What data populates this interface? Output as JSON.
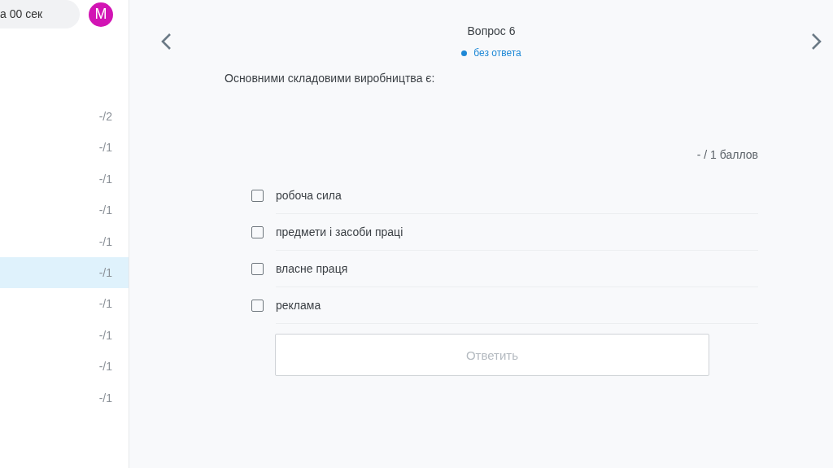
{
  "timer": {
    "text": "а 00 сек"
  },
  "avatar": {
    "letter": "M"
  },
  "sidebar": {
    "items": [
      {
        "score": "-/2",
        "selected": false
      },
      {
        "score": "-/1",
        "selected": false
      },
      {
        "score": "-/1",
        "selected": false
      },
      {
        "score": "-/1",
        "selected": false
      },
      {
        "score": "-/1",
        "selected": false
      },
      {
        "score": "-/1",
        "selected": true
      },
      {
        "score": "-/1",
        "selected": false
      },
      {
        "score": "-/1",
        "selected": false
      },
      {
        "score": "-/1",
        "selected": false
      },
      {
        "score": "-/1",
        "selected": false
      }
    ]
  },
  "question": {
    "title": "Вопрос 6",
    "status": {
      "label": "без ответа",
      "answered": false
    },
    "text": "Основними складовими виробництва є:",
    "points": "- / 1  баллов",
    "options": [
      {
        "label": "робоча сила",
        "checked": false
      },
      {
        "label": "предмети і засоби праці",
        "checked": false
      },
      {
        "label": "власне праця",
        "checked": false
      },
      {
        "label": "реклама",
        "checked": false
      }
    ]
  },
  "submit": {
    "label": "Ответить",
    "disabled": true
  }
}
